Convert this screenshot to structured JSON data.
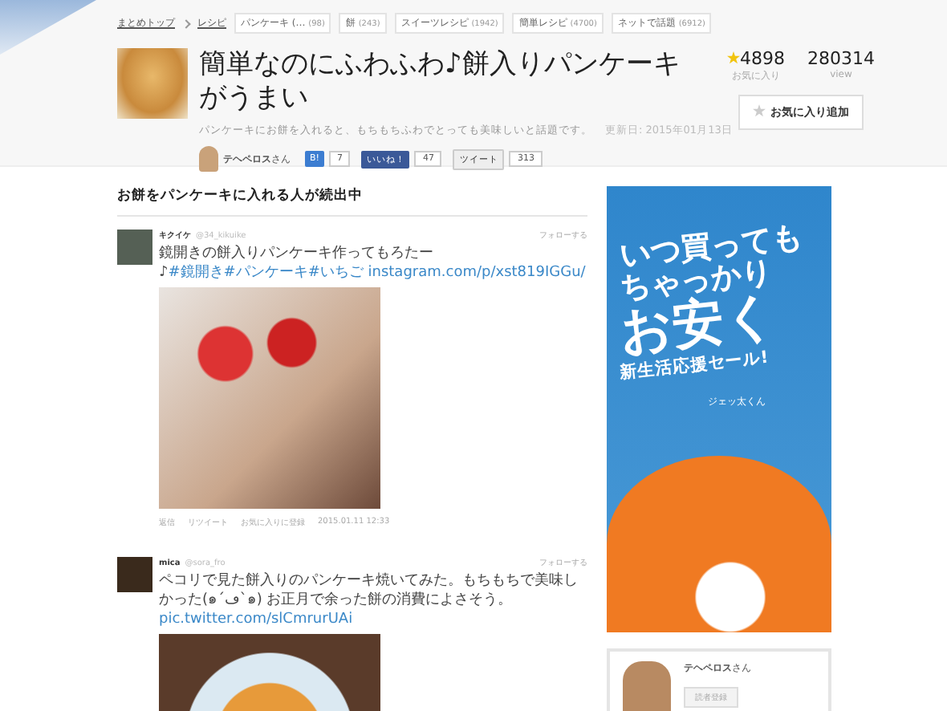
{
  "breadcrumb": [
    "まとめトップ",
    "レシピ"
  ],
  "tags": [
    {
      "label": "パンケーキ (…",
      "count": "(98)"
    },
    {
      "label": "餅",
      "count": "(243)"
    },
    {
      "label": "スイーツレシピ",
      "count": "(1942)"
    },
    {
      "label": "簡単レシピ",
      "count": "(4700)"
    },
    {
      "label": "ネットで話題",
      "count": "(6912)"
    }
  ],
  "article": {
    "title": "簡単なのにふわふわ♪餅入りパンケーキがうまい",
    "description": "パンケーキにお餅を入れると、もちもちふわでとっても美味しいと話題です。",
    "updated": "更新日: 2015年01月13日",
    "author": "テヘペロス",
    "author_suffix": "さん",
    "share": [
      {
        "kind": "hatena",
        "label": "B!",
        "count": "7"
      },
      {
        "kind": "facebook",
        "label": "いいね！",
        "count": "47"
      },
      {
        "kind": "twitter",
        "label": "ツイート",
        "count": "313"
      }
    ]
  },
  "stats": {
    "favorites": "4898",
    "favorites_label": "お気に入り",
    "views": "280314",
    "views_label": "view",
    "favorite_button": "お気に入り追加"
  },
  "section_heading": "お餅をパンケーキに入れる人が続出中",
  "tweets": [
    {
      "name": "キクイケ",
      "handle": "@34_kikuike",
      "follow": "フォローする",
      "text": "鏡開きの餅入りパンケーキ作ってもろたー♪",
      "hashtags": "#鏡開き#パンケーキ#いちご",
      "link": "instagram.com/p/xst819IGGu/",
      "photo": {
        "kind": "strawberry"
      },
      "actions": [
        "返信",
        "リツイート",
        "お気に入りに登録"
      ],
      "time": "2015.01.11 12:33"
    },
    {
      "name": "mica",
      "handle": "@sora_fro",
      "follow": "フォローする",
      "text": "ペコリで見た餅入りのパンケーキ焼いてみた。もちもちで美味しかった(๑´ڡ`๑) お正月で余った餅の消費によさそう。",
      "link": "pic.twitter.com/slCmrurUAi",
      "photo": {
        "kind": "plate"
      }
    }
  ],
  "ad": {
    "lines": [
      "いつ買っても",
      "ちゃっかり",
      "お安く",
      "新生活応援セール!"
    ],
    "signature": "ジェッ太くん"
  },
  "author_card": {
    "name": "テヘペロス",
    "suffix": "さん",
    "button": "読者登録"
  }
}
